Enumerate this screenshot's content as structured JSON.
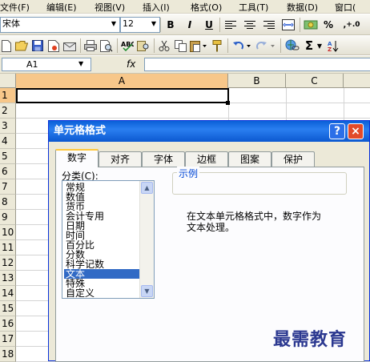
{
  "menu": {
    "items": [
      "文件(F)",
      "编辑(E)",
      "视图(V)",
      "插入(I)",
      "格式(O)",
      "工具(T)",
      "数据(D)",
      "窗口("
    ]
  },
  "toolbar": {
    "font_name": "宋体",
    "font_size": "12",
    "bold": "B",
    "italic": "I",
    "underline": "U",
    "percent": "%",
    "sigma": "Σ"
  },
  "formula_bar": {
    "name_box": "A1",
    "fx": "fx"
  },
  "sheet": {
    "columns": [
      "A",
      "B",
      "C"
    ],
    "rows": [
      "1",
      "2",
      "3",
      "4",
      "5",
      "6",
      "7",
      "8",
      "9",
      "10",
      "11",
      "12",
      "13",
      "14",
      "15",
      "16",
      "17",
      "18"
    ]
  },
  "dialog": {
    "title": "单元格格式",
    "help": "?",
    "close": "×",
    "tabs": [
      "数字",
      "对齐",
      "字体",
      "边框",
      "图案",
      "保护"
    ],
    "category_label": "分类(C):",
    "categories": [
      "常规",
      "数值",
      "货币",
      "会计专用",
      "日期",
      "时间",
      "百分比",
      "分数",
      "科学记数",
      "文本",
      "特殊",
      "自定义"
    ],
    "selected_category": "文本",
    "sample_label": "示例",
    "description_line1": "在文本单元格格式中，数字作为",
    "description_line2": "文本处理。"
  },
  "watermark": "最需教育",
  "colors": {
    "active_column": "#f7c78a",
    "selection": "#316ac5",
    "titlebar": "#0a5fd8"
  }
}
